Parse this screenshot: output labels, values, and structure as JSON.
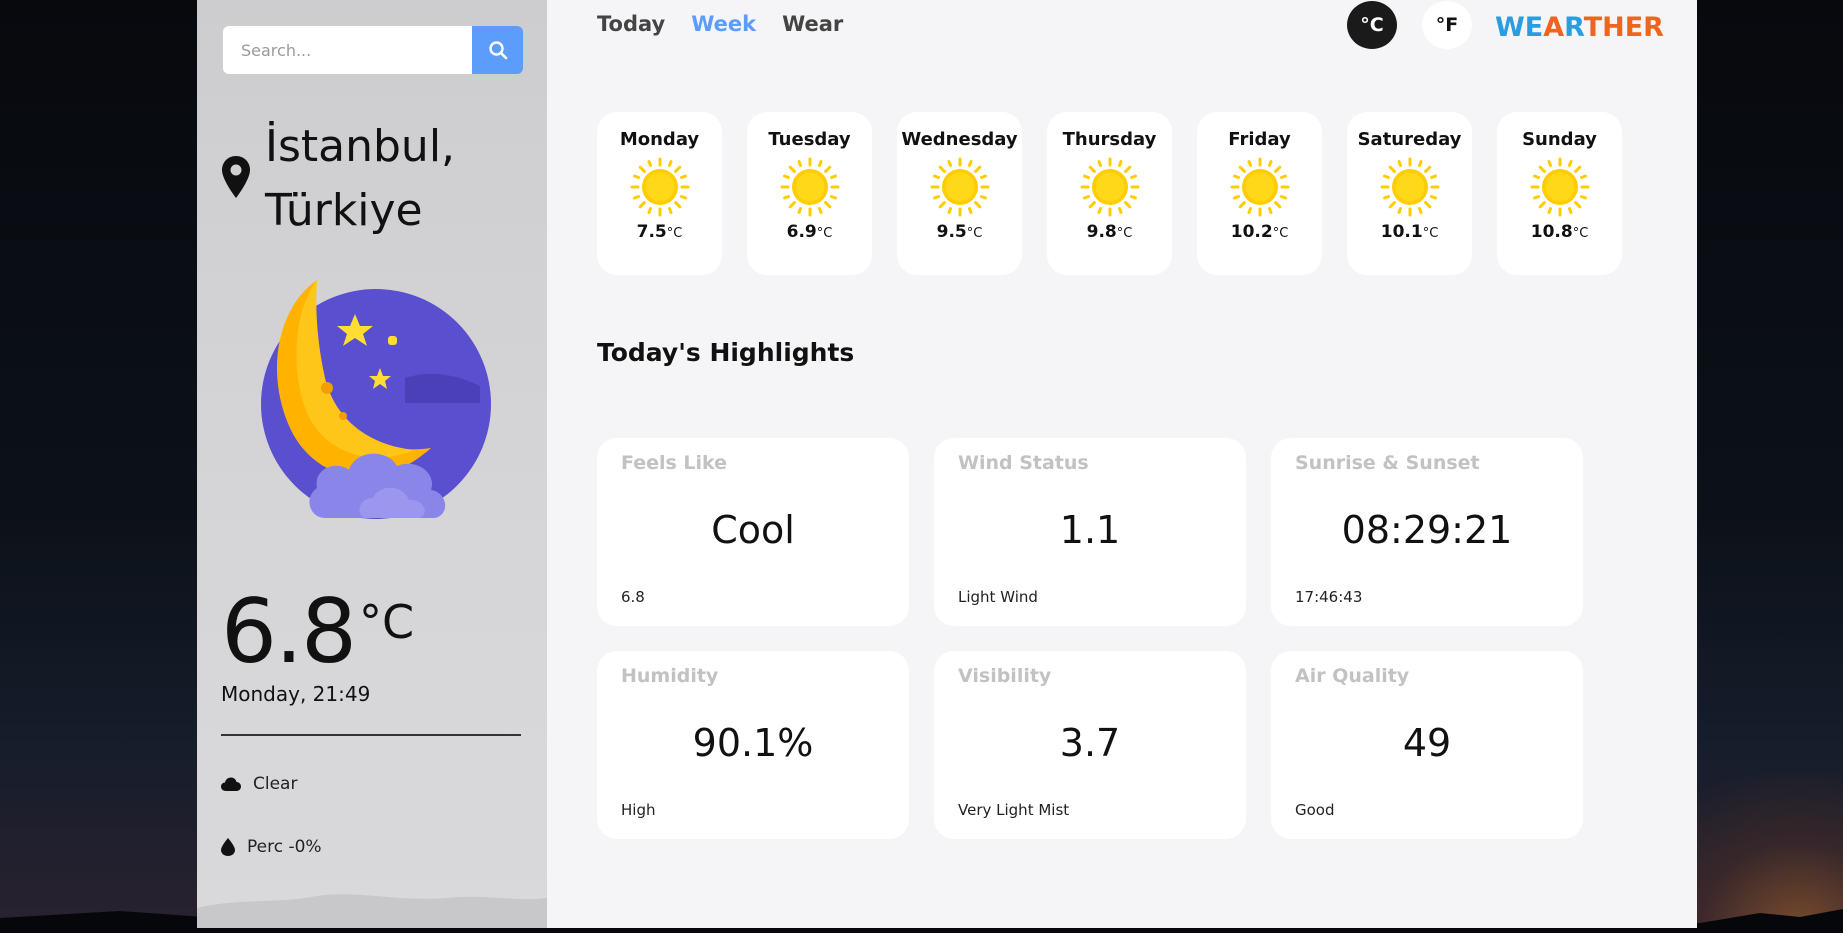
{
  "search": {
    "placeholder": "Search..."
  },
  "location": {
    "line1": "İstanbul,",
    "line2": "Türkiye"
  },
  "current": {
    "temp": "6.8",
    "unit": "°C",
    "datetime": "Monday, 21:49",
    "condition": "Clear",
    "precipitation": "Perc -0%"
  },
  "nav": {
    "tabs": [
      {
        "label": "Today"
      },
      {
        "label": "Week"
      },
      {
        "label": "Wear"
      }
    ],
    "active_tab": "Week",
    "unit_c": "°C",
    "unit_f": "°F",
    "logo_part1": "WE",
    "logo_part2": "A",
    "logo_part3": "R",
    "logo_part4": "THER"
  },
  "week": [
    {
      "day": "Monday",
      "temp": "7.5",
      "unit": "°C",
      "icon": "sun-icon"
    },
    {
      "day": "Tuesday",
      "temp": "6.9",
      "unit": "°C",
      "icon": "sun-icon"
    },
    {
      "day": "Wednesday",
      "temp": "9.5",
      "unit": "°C",
      "icon": "sun-icon"
    },
    {
      "day": "Thursday",
      "temp": "9.8",
      "unit": "°C",
      "icon": "sun-icon"
    },
    {
      "day": "Friday",
      "temp": "10.2",
      "unit": "°C",
      "icon": "sun-icon"
    },
    {
      "day": "Satureday",
      "temp": "10.1",
      "unit": "°C",
      "icon": "sun-icon"
    },
    {
      "day": "Sunday",
      "temp": "10.8",
      "unit": "°C",
      "icon": "sun-icon"
    }
  ],
  "highlights": {
    "title": "Today's Highlights",
    "cards": [
      {
        "title": "Feels Like",
        "value": "Cool",
        "sub": "6.8"
      },
      {
        "title": "Wind Status",
        "value": "1.1",
        "sub": "Light Wind"
      },
      {
        "title": "Sunrise & Sunset",
        "value": "08:29:21",
        "sub": "17:46:43"
      },
      {
        "title": "Humidity",
        "value": "90.1%",
        "sub": "High"
      },
      {
        "title": "Visibility",
        "value": "3.7",
        "sub": "Very Light Mist"
      },
      {
        "title": "Air Quality",
        "value": "49",
        "sub": "Good"
      }
    ]
  },
  "colors": {
    "accent": "#5c9dfb",
    "logo_blue": "#2a9ce0",
    "logo_orange": "#f06420",
    "moon_disc": "#5a4fcf",
    "sun": "#ffcc00"
  },
  "icons": {
    "search": "search-icon",
    "location": "map-pin-icon",
    "current_weather": "moon-night-icon",
    "condition": "cloud-icon",
    "precipitation": "droplet-icon"
  }
}
